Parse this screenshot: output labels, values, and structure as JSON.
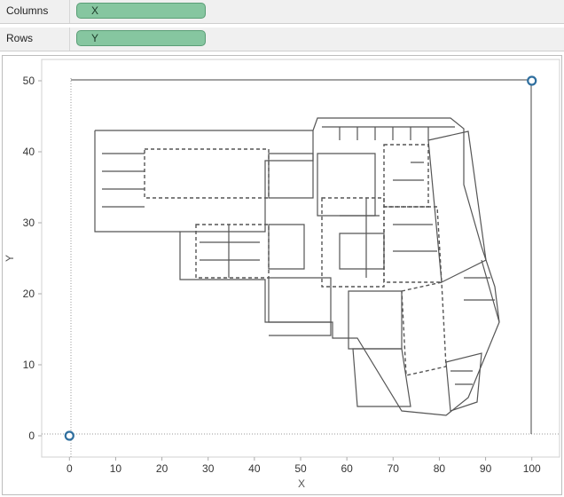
{
  "shelves": {
    "columns": {
      "label": "Columns",
      "pill": "X"
    },
    "rows": {
      "label": "Rows",
      "pill": "Y"
    }
  },
  "chart_data": {
    "type": "scatter",
    "x_label": "X",
    "y_label": "Y",
    "x_ticks": [
      "0",
      "10",
      "20",
      "30",
      "40",
      "50",
      "60",
      "70",
      "80",
      "90",
      "100"
    ],
    "y_ticks": [
      "0",
      "10",
      "20",
      "30",
      "40",
      "50"
    ],
    "xlim": [
      -6,
      106
    ],
    "ylim": [
      -3,
      53
    ],
    "points": [
      {
        "x": 0,
        "y": 0
      },
      {
        "x": 100,
        "y": 50
      }
    ],
    "background": "floor plan image",
    "point_color": "#2f6f9f"
  }
}
